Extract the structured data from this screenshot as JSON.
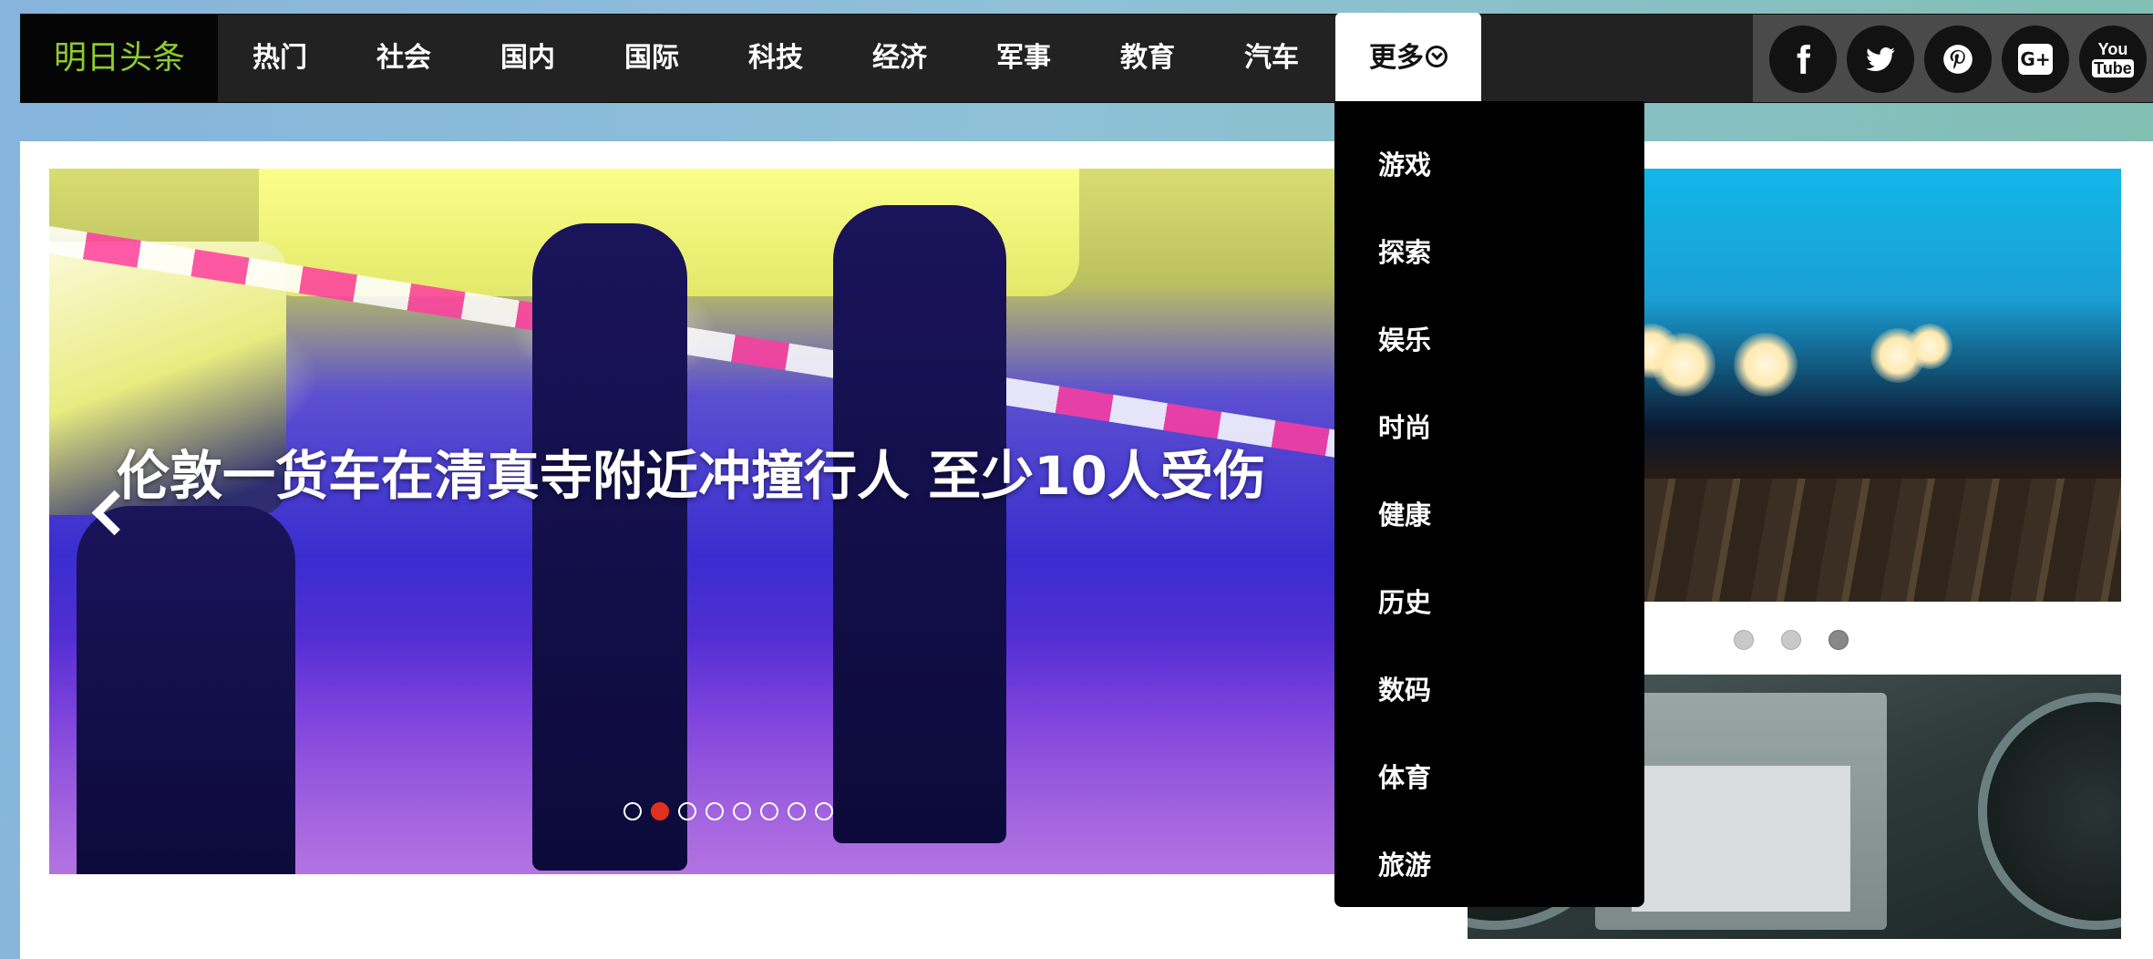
{
  "brand": "明日头条",
  "nav": {
    "items": [
      "热门",
      "社会",
      "国内",
      "国际",
      "科技",
      "经济",
      "军事",
      "教育",
      "汽车"
    ],
    "more_label": "更多"
  },
  "dropdown": {
    "items": [
      "游戏",
      "探索",
      "娱乐",
      "时尚",
      "健康",
      "历史",
      "数码",
      "体育",
      "旅游"
    ]
  },
  "social": {
    "icons": [
      "facebook-icon",
      "twitter-icon",
      "pinterest-icon",
      "google-plus-icon",
      "youtube-icon"
    ],
    "google_plus_label": "G+",
    "youtube_top": "You",
    "youtube_bottom": "Tube"
  },
  "carousel": {
    "caption": "伦敦一货车在清真寺附近冲撞行人 至少10人受伤",
    "slide_count": 8,
    "active_slide": 2
  },
  "side_carousel": {
    "slide_count": 3,
    "active_slide": 3
  },
  "colors": {
    "brand_text": "#8ccc2a",
    "nav_bg": "#222222",
    "active_dot": "#e0311e",
    "dropdown_bg": "#000000"
  }
}
